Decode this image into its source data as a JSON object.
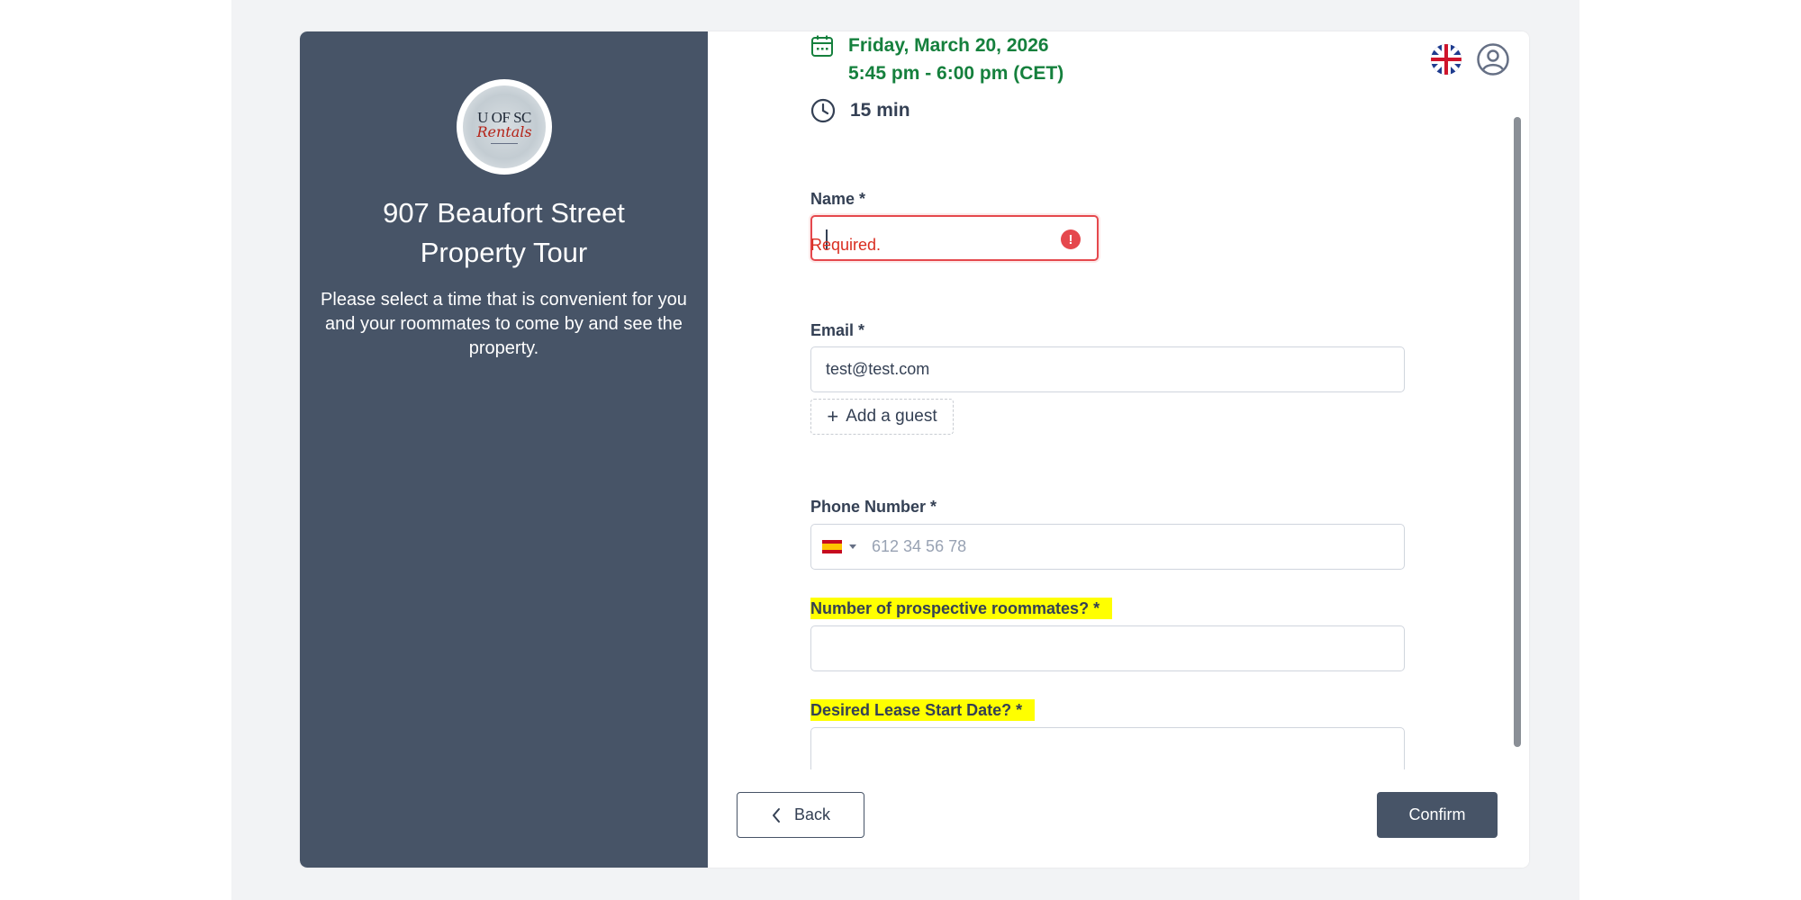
{
  "logo": {
    "line1": "U OF SC",
    "line2": "Rentals"
  },
  "event": {
    "title_line1": "907 Beaufort Street",
    "title_line2": "Property Tour",
    "description": "Please select a time that is convenient for you and your roommates to come by and see the property."
  },
  "schedule": {
    "date": "Friday, March 20, 2026",
    "time": "5:45 pm - 6:00 pm (CET)",
    "duration": "15 min"
  },
  "form": {
    "name": {
      "label": "Name *",
      "value": "",
      "error": "Required.",
      "error_icon": "!"
    },
    "email": {
      "label": "Email *",
      "value": "test@test.com"
    },
    "add_guest": {
      "icon": "+",
      "label": "Add a guest"
    },
    "phone": {
      "label": "Phone Number *",
      "country": "ES",
      "placeholder": "612 34 56 78"
    },
    "roommates": {
      "label": "Number of prospective roommates? *",
      "value": ""
    },
    "lease_start": {
      "label": "Desired Lease Start Date? *",
      "value": ""
    }
  },
  "actions": {
    "back_label": "Back",
    "confirm_label": "Confirm"
  },
  "colors": {
    "panel": "#475467",
    "accent_green": "#15803d",
    "error": "#e5484d",
    "highlight": "#ffff00"
  },
  "icons": {
    "calendar": "calendar-icon",
    "clock": "clock-icon",
    "language": "uk-flag-icon",
    "user": "user-circle-icon",
    "back": "chevron-left-icon"
  }
}
